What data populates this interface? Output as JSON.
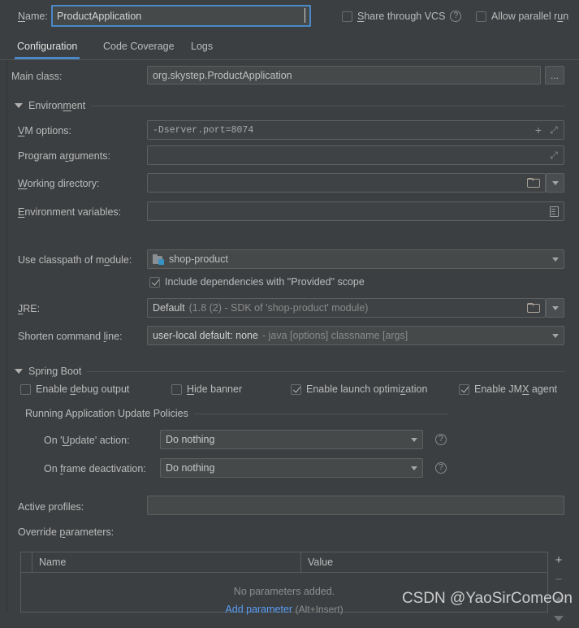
{
  "header": {
    "name_label": "Name:",
    "name_value": "ProductApplication",
    "share_vcs_label": "Share through VCS",
    "share_vcs_checked": false,
    "help_icon": "question-circle-icon",
    "allow_parallel_label": "Allow parallel run",
    "allow_parallel_checked": false
  },
  "tabs": [
    {
      "label": "Configuration",
      "active": true
    },
    {
      "label": "Code Coverage",
      "active": false
    },
    {
      "label": "Logs",
      "active": false
    }
  ],
  "main_class": {
    "label": "Main class:",
    "value": "org.skystep.ProductApplication",
    "browse_button": "..."
  },
  "environment": {
    "section_title": "Environment",
    "vm_options": {
      "label": "VM options:",
      "value": "-Dserver.port=8074",
      "icons": [
        "plus-icon",
        "expand-icon"
      ]
    },
    "program_arguments": {
      "label": "Program arguments:",
      "value": "",
      "icons": [
        "expand-icon"
      ]
    },
    "working_directory": {
      "label": "Working directory:",
      "value": "",
      "icons": [
        "folder-icon",
        "chevron-down-icon"
      ]
    },
    "environment_variables": {
      "label": "Environment variables:",
      "value": "",
      "icons": [
        "list-icon"
      ]
    },
    "use_classpath": {
      "label": "Use classpath of module:",
      "value": "shop-product",
      "icon": "module-icon"
    },
    "include_provided": {
      "label": "Include dependencies with \"Provided\" scope",
      "checked": true
    },
    "jre": {
      "label": "JRE:",
      "value": "Default",
      "value_detail": "(1.8 (2) - SDK of 'shop-product' module)",
      "icons": [
        "folder-icon",
        "chevron-down-icon"
      ]
    },
    "shorten_command_line": {
      "label": "Shorten command line:",
      "value": "user-local default: none",
      "value_detail": "- java [options] classname [args]"
    }
  },
  "spring_boot": {
    "section_title": "Spring Boot",
    "checkboxes": [
      {
        "label": "Enable debug output",
        "checked": false
      },
      {
        "label": "Hide banner",
        "checked": false
      },
      {
        "label": "Enable launch optimization",
        "checked": true
      },
      {
        "label": "Enable JMX agent",
        "checked": true
      }
    ],
    "update_policies": {
      "section_title": "Running Application Update Policies",
      "on_update": {
        "label": "On 'Update' action:",
        "value": "Do nothing"
      },
      "on_frame_deactivation": {
        "label": "On frame deactivation:",
        "value": "Do nothing"
      }
    },
    "active_profiles": {
      "label": "Active profiles:",
      "value": ""
    },
    "override_parameters": {
      "label": "Override parameters:",
      "columns": [
        "Name",
        "Value"
      ],
      "rows": [],
      "empty_text": "No parameters added.",
      "add_link": "Add parameter",
      "add_hint": "(Alt+Insert)",
      "side_buttons": [
        "add-icon",
        "remove-icon",
        "move-up-icon",
        "move-down-icon"
      ]
    }
  },
  "watermark": "CSDN @YaoSirComeOn",
  "colors": {
    "accent": "#4a88c7",
    "link": "#589df6",
    "background": "#3c3f41",
    "field": "#45494a",
    "module_badge": "#3592c4"
  }
}
